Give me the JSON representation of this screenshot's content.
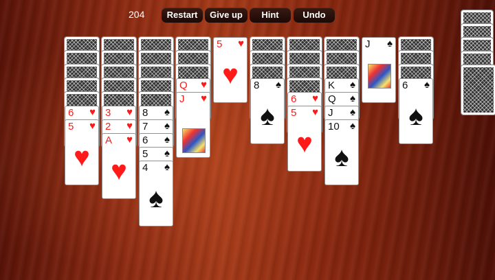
{
  "score": "204",
  "toolbar": {
    "restart_label": "Restart",
    "giveup_label": "Give up",
    "hint_label": "Hint",
    "undo_label": "Undo"
  },
  "colors": {
    "red": "#ff1a1a",
    "black": "#111111",
    "table": "#8c2a12"
  },
  "tableau": [
    {
      "hidden": 5,
      "face_up": [
        {
          "rank": "6",
          "suit": "♥"
        },
        {
          "rank": "5",
          "suit": "♥"
        }
      ]
    },
    {
      "hidden": 5,
      "face_up": [
        {
          "rank": "3",
          "suit": "♥"
        },
        {
          "rank": "2",
          "suit": "♥"
        },
        {
          "rank": "A",
          "suit": "♥"
        }
      ]
    },
    {
      "hidden": 5,
      "face_up": [
        {
          "rank": "8",
          "suit": "♠"
        },
        {
          "rank": "7",
          "suit": "♠"
        },
        {
          "rank": "6",
          "suit": "♠"
        },
        {
          "rank": "5",
          "suit": "♠"
        },
        {
          "rank": "4",
          "suit": "♠"
        }
      ]
    },
    {
      "hidden": 3,
      "face_up": [
        {
          "rank": "Q",
          "suit": "♥"
        },
        {
          "rank": "J",
          "suit": "♥"
        }
      ]
    },
    {
      "hidden": 0,
      "face_up": [
        {
          "rank": "5",
          "suit": "♥"
        }
      ]
    },
    {
      "hidden": 3,
      "face_up": [
        {
          "rank": "8",
          "suit": "♠"
        }
      ]
    },
    {
      "hidden": 4,
      "face_up": [
        {
          "rank": "6",
          "suit": "♥"
        },
        {
          "rank": "5",
          "suit": "♥"
        }
      ]
    },
    {
      "hidden": 3,
      "face_up": [
        {
          "rank": "K",
          "suit": "♠"
        },
        {
          "rank": "Q",
          "suit": "♠"
        },
        {
          "rank": "J",
          "suit": "♠"
        },
        {
          "rank": "10",
          "suit": "♠"
        }
      ]
    },
    {
      "hidden": 0,
      "face_up": [
        {
          "rank": "J",
          "suit": "♠"
        }
      ]
    },
    {
      "hidden": 3,
      "face_up": [
        {
          "rank": "6",
          "suit": "♠"
        }
      ]
    }
  ],
  "stock": {
    "piles": 5
  }
}
